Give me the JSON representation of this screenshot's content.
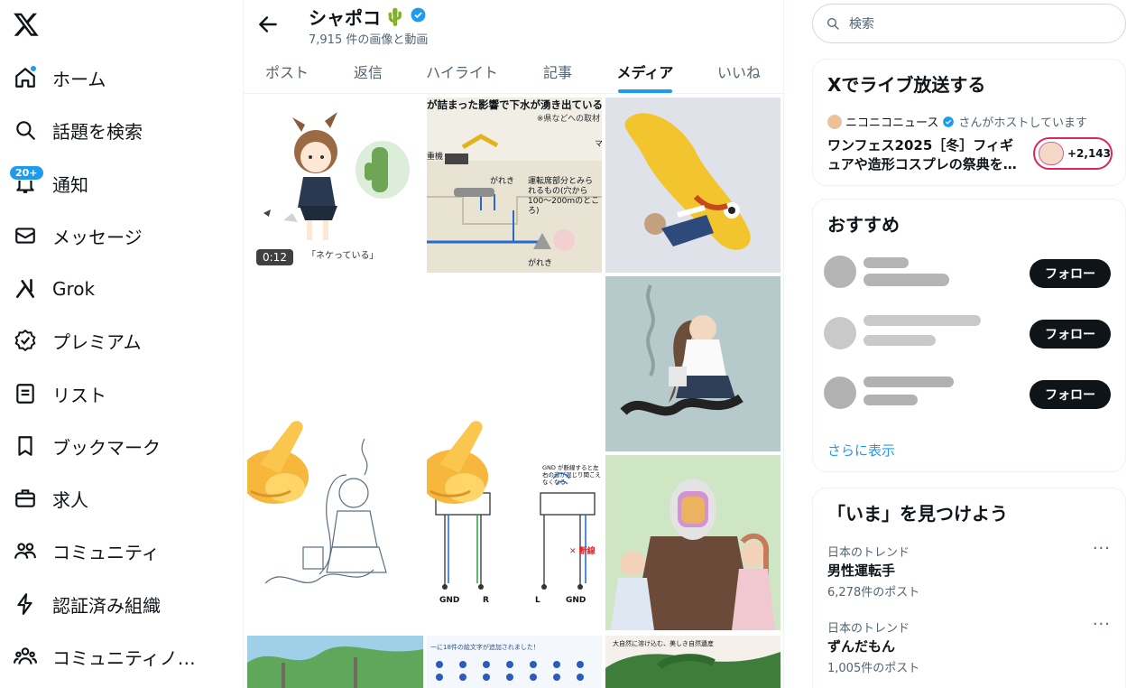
{
  "nav": {
    "items": [
      {
        "label": "ホーム",
        "icon": "home-icon"
      },
      {
        "label": "話題を検索",
        "icon": "search-icon"
      },
      {
        "label": "通知",
        "icon": "bell-icon",
        "badge": "20+"
      },
      {
        "label": "メッセージ",
        "icon": "mail-icon"
      },
      {
        "label": "Grok",
        "icon": "grok-icon"
      },
      {
        "label": "プレミアム",
        "icon": "premium-icon"
      },
      {
        "label": "リスト",
        "icon": "list-icon"
      },
      {
        "label": "ブックマーク",
        "icon": "bookmark-icon"
      },
      {
        "label": "求人",
        "icon": "briefcase-icon"
      },
      {
        "label": "コミュニティ",
        "icon": "community-icon"
      },
      {
        "label": "認証済み組織",
        "icon": "lightning-icon"
      },
      {
        "label": "コミュニティノ…",
        "icon": "community-notes-icon"
      }
    ]
  },
  "profile": {
    "name": "シャポコ",
    "name_emoji": "🌵",
    "media_count": "7,915 件の画像と動画"
  },
  "tabs": [
    "ポスト",
    "返信",
    "ハイライト",
    "記事",
    "メディア",
    "いいね"
  ],
  "active_tab": "メディア",
  "media": {
    "video_duration": "0:12",
    "tile1_caption": "「ネケっている」",
    "tile2_headline": "が詰まった影響で下水が湧き出ていると",
    "tile2_source": "※県などへの取材",
    "tile2_label_a": "重機",
    "tile2_label_b": "がれき",
    "tile2_label_c": "運転席部分とみられるもの(穴から100〜200mのところ)",
    "tile2_label_d": "がれき",
    "tile2_label_e": "マ",
    "tile5_note": "GND が断線すると左右の音が混じり聞こえなくなる",
    "tile5_label_gnd1": "GND",
    "tile5_label_r": "R",
    "tile5_label_l": "L",
    "tile5_label_gnd2": "GND",
    "tile5_break": "✕ 断線",
    "tile8_banner": "一に18件の絵文字が追加されました！",
    "tile9_banner": "大自然に溶け込む、美しき自然遺産"
  },
  "search": {
    "placeholder": "検索"
  },
  "live": {
    "title": "Xでライブ放送する",
    "host_name": "ニコニコニュース",
    "host_suffix": "さんがホストしています",
    "event_title": "ワンフェス2025［冬］フィギュアや造形コスプレの祭典を…",
    "listeners": "+2,143"
  },
  "recommend": {
    "title": "おすすめ",
    "follow_label": "フォロー",
    "show_more": "さらに表示"
  },
  "trends": {
    "title": "「いま」を見つけよう",
    "items": [
      {
        "category": "日本のトレンド",
        "name": "男性運転手",
        "count": "6,278件のポスト"
      },
      {
        "category": "日本のトレンド",
        "name": "ずんだもん",
        "count": "1,005件のポスト"
      }
    ]
  },
  "colors": {
    "accent": "#1d9bf0",
    "text": "#0f1419",
    "muted": "#536471"
  }
}
